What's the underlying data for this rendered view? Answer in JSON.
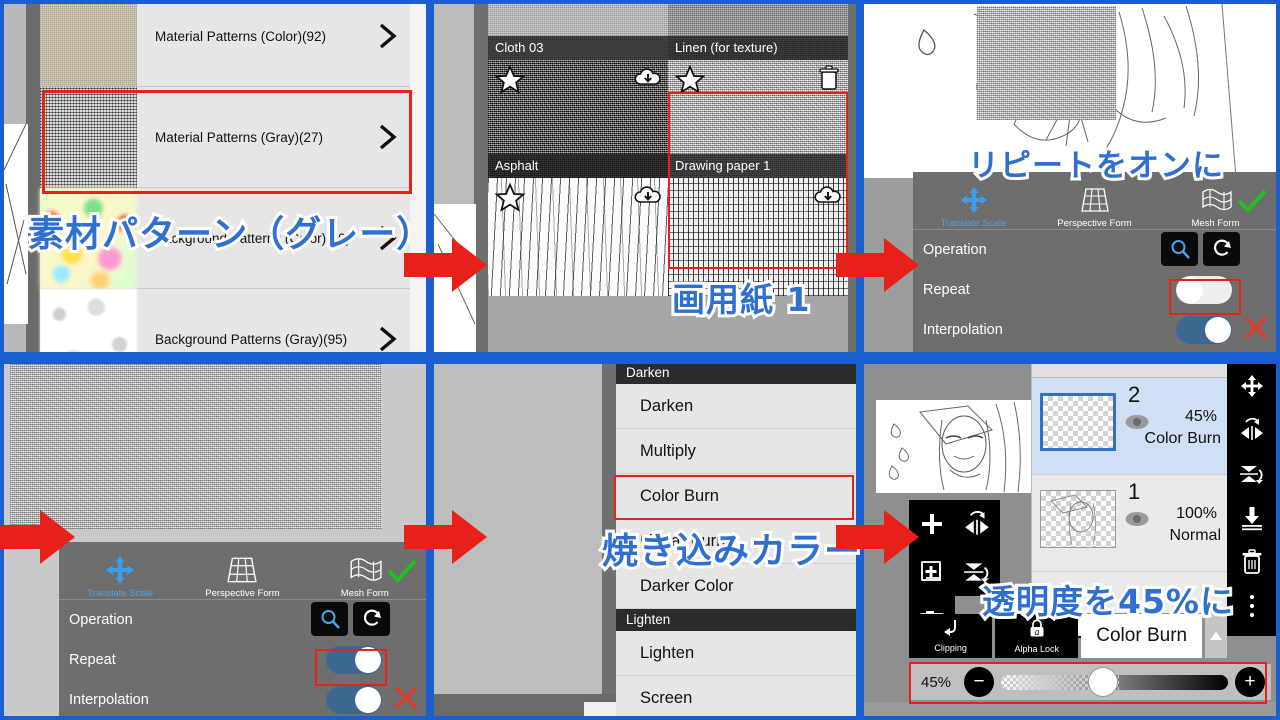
{
  "meta": {
    "accent_blue": "#1a5fd0",
    "annotation_red": "#e8201a",
    "annotation_text_blue": "#2f6fd0"
  },
  "panel1": {
    "name": "material-pattern-category-list",
    "rows": [
      {
        "label": "Material Patterns (Color)(92)",
        "thumb": "beige-grain"
      },
      {
        "label": "Material Patterns (Gray)(27)",
        "thumb": "gray-weave"
      },
      {
        "label": "Background Patterns (Color)(40)",
        "thumb": "color-bokeh"
      },
      {
        "label": "Background Patterns (Gray)(95)",
        "thumb": "white-flowers"
      }
    ],
    "annotation": "素材パターン（グレー）",
    "chevron_icon": "chevron-right-icon"
  },
  "panel2": {
    "name": "material-thumbnail-grid",
    "cells": [
      {
        "caption": "Cloth 03",
        "thumb": "cloth",
        "badge": "star-icon",
        "action": "cloud-download-icon"
      },
      {
        "caption": "Linen (for texture)",
        "thumb": "linen",
        "badge": "star-icon",
        "action": "cloud-download-icon"
      },
      {
        "caption": "Asphalt",
        "thumb": "asphalt",
        "badge": "star-icon",
        "action": "cloud-download-icon"
      },
      {
        "caption": "Drawing paper 1",
        "thumb": "drawing-paper",
        "badge": "star-icon",
        "action": "trash-icon"
      },
      {
        "caption": "",
        "thumb": "white-scratch",
        "badge": "star-icon",
        "action": "cloud-download-icon"
      },
      {
        "caption": "",
        "thumb": "hatch",
        "badge": "star-icon",
        "action": "cloud-download-icon"
      }
    ],
    "annotation": "画用紙 1"
  },
  "panel3": {
    "name": "transform-toolbar-repeat-off",
    "annotation": "リピートをオンに",
    "tools": [
      {
        "label": "Translate Scale",
        "icon": "move-arrows-icon",
        "active": true
      },
      {
        "label": "Perspective Form",
        "icon": "perspective-grid-icon",
        "active": false
      },
      {
        "label": "Mesh Form",
        "icon": "mesh-flag-icon",
        "active": false
      }
    ],
    "rows": [
      {
        "label": "Operation",
        "type": "buttons",
        "buttons": [
          "magnifier-icon",
          "rotate-icon"
        ]
      },
      {
        "label": "Repeat",
        "type": "toggle",
        "value": "off"
      },
      {
        "label": "Interpolation",
        "type": "toggle",
        "value": "on"
      }
    ],
    "confirm_icon": "check-icon",
    "cancel_icon": "x-icon"
  },
  "panel4": {
    "name": "transform-toolbar-repeat-on",
    "tools": [
      {
        "label": "Translate Scale",
        "icon": "move-arrows-icon",
        "active": true
      },
      {
        "label": "Perspective Form",
        "icon": "perspective-grid-icon",
        "active": false
      },
      {
        "label": "Mesh Form",
        "icon": "mesh-flag-icon",
        "active": false
      }
    ],
    "rows": [
      {
        "label": "Operation",
        "type": "buttons",
        "buttons": [
          "magnifier-icon",
          "rotate-icon"
        ]
      },
      {
        "label": "Repeat",
        "type": "toggle",
        "value": "on"
      },
      {
        "label": "Interpolation",
        "type": "toggle",
        "value": "on"
      }
    ],
    "confirm_icon": "check-icon",
    "cancel_icon": "x-icon"
  },
  "panel5": {
    "name": "blend-mode-menu",
    "annotation": "焼き込みカラー",
    "items": [
      {
        "label": "Darken",
        "type": "group"
      },
      {
        "label": "Darken",
        "type": "item"
      },
      {
        "label": "Multiply",
        "type": "item"
      },
      {
        "label": "Color Burn",
        "type": "item",
        "highlighted": true
      },
      {
        "label": "Linear Burn",
        "type": "item"
      },
      {
        "label": "Darker Color",
        "type": "item"
      },
      {
        "label": "Lighten",
        "type": "group"
      },
      {
        "label": "Lighten",
        "type": "item"
      },
      {
        "label": "Screen",
        "type": "item"
      }
    ]
  },
  "panel6": {
    "name": "layer-panel",
    "annotation": "透明度を45%に",
    "layers": [
      {
        "number": "2",
        "opacity": "45%",
        "mode": "Color Burn",
        "selected": true,
        "visibility_icon": "eye-icon"
      },
      {
        "number": "1",
        "opacity": "100%",
        "mode": "Normal",
        "selected": false,
        "visibility_icon": "eye-icon"
      }
    ],
    "left_tools": [
      "add-layer-icon",
      "flip-horizontal-icon",
      "duplicate-layer-icon",
      "flip-vertical-icon",
      "camera-icon"
    ],
    "right_tools": [
      "move-arrows-icon",
      "flip-horizontal-icon",
      "flip-vertical-icon",
      "merge-down-icon",
      "trash-icon",
      "more-options-icon"
    ],
    "bottom_buttons": [
      {
        "label": "Clipping",
        "icon": "clipping-arrow-icon"
      },
      {
        "label": "Alpha Lock",
        "icon": "alpha-lock-icon"
      }
    ],
    "mode_selector": {
      "value": "Color Burn",
      "caret_icon": "caret-up-icon"
    },
    "opacity_slider": {
      "value": "45%",
      "minus_icon": "minus-icon",
      "plus_icon": "plus-icon",
      "percent": 45
    }
  },
  "arrows": [
    {
      "name": "flow-arrow-1"
    },
    {
      "name": "flow-arrow-2"
    },
    {
      "name": "flow-arrow-3"
    },
    {
      "name": "flow-arrow-4"
    },
    {
      "name": "flow-arrow-5"
    }
  ]
}
